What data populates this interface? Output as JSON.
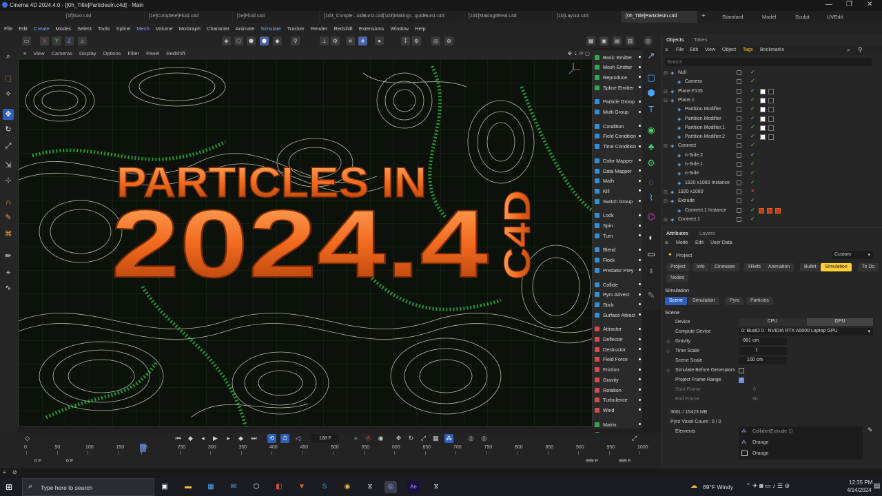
{
  "window": {
    "title": "Cinema 4D 2024.4.0 - [[0h_Title]ParticlesIn.c4d] - Main",
    "min": "—",
    "max": "❐",
    "close": "✕"
  },
  "file_tabs": [
    "[1f]Goo.c4d",
    "[1e]Complete]Fluid.c4d",
    "[1e]Fluid.c4d",
    "[1d3_Comple...uidBurst.c4d",
    "[1d3]MakingI...quidBurst.c4d",
    "[1d1]MakingItReal.c4d",
    "[1b]Layout.c4d",
    "[0h_Title]ParticlesIn.c4d"
  ],
  "tab_add": "+",
  "layout_tabs": [
    "Standard",
    "Model",
    "Sculpt",
    "UVEdit"
  ],
  "menu": [
    "File",
    "Edit",
    "Create",
    "Modes",
    "Select",
    "Tools",
    "Spline",
    "Mesh",
    "Volume",
    "MoGraph",
    "Character",
    "Animate",
    "Simulate",
    "Tracker",
    "Render",
    "Redshift",
    "Extensions",
    "Window",
    "Help"
  ],
  "toolbar": {
    "x": "X",
    "y": "Y",
    "z": "Z"
  },
  "viewport_menu": [
    "View",
    "Cameras",
    "Display",
    "Options",
    "Filter",
    "Panel",
    "Redshift"
  ],
  "scene": {
    "line1": "PARTICLES IN",
    "line2": "2024.4",
    "tag": "C4D"
  },
  "sim_groups": [
    {
      "color": "#2fa84a",
      "items": [
        "Basic Emitter",
        "Mesh Emitter",
        "Reproduce",
        "Spline Emitter"
      ]
    },
    {
      "color": "#2f8fd8",
      "items": [
        "Particle Group",
        "Multi Group"
      ]
    },
    {
      "color": "#2f8fd8",
      "items": [
        "Condition",
        "Field Condition",
        "Time Condition"
      ]
    },
    {
      "color": "#2f8fd8",
      "items": [
        "Color Mapper",
        "Data Mapper",
        "Math",
        "Kill",
        "Switch Group"
      ]
    },
    {
      "color": "#2f8fd8",
      "items": [
        "Look",
        "Spin",
        "Turn"
      ]
    },
    {
      "color": "#2f8fd8",
      "items": [
        "Blend",
        "Flock",
        "Predator Prey"
      ]
    },
    {
      "color": "#2f8fd8",
      "items": [
        "Collide",
        "Pyro Advect",
        "Stick",
        "Surface Attract"
      ]
    },
    {
      "color": "#d84a4a",
      "items": [
        "Attractor",
        "Deflector",
        "Destructor",
        "Field Force",
        "Friction",
        "Gravity",
        "Rotation",
        "Turbulence",
        "Wind"
      ]
    },
    {
      "color": "#2fa84a",
      "items": [
        "Matrix",
        "Tracer"
      ]
    }
  ],
  "objects_panel": {
    "tabs": [
      "Objects",
      "Takes"
    ],
    "menu": [
      "File",
      "Edit",
      "View",
      "Object",
      "Tags",
      "Bookmarks"
    ],
    "search_placeholder": "Search",
    "rows": [
      {
        "name": "Null",
        "indent": 0,
        "status": "check"
      },
      {
        "name": "Camera",
        "indent": 1,
        "status": "check"
      },
      {
        "name": "Plane.F135",
        "indent": 0,
        "status": "check"
      },
      {
        "name": "Plane.1",
        "indent": 0,
        "status": "check"
      },
      {
        "name": "Partition Modifier",
        "indent": 1,
        "status": "check"
      },
      {
        "name": "Partition Modifier",
        "indent": 1,
        "status": "check"
      },
      {
        "name": "Partition Modifier.1",
        "indent": 1,
        "status": "check"
      },
      {
        "name": "Partition Modifier.2",
        "indent": 1,
        "status": "check"
      },
      {
        "name": "Connect",
        "indent": 0,
        "status": "check"
      },
      {
        "name": "n-Side.2",
        "indent": 1,
        "status": "check"
      },
      {
        "name": "n-Side.1",
        "indent": 1,
        "status": "check"
      },
      {
        "name": "n-Side",
        "indent": 1,
        "status": "check"
      },
      {
        "name": "1920 x1080 Instance",
        "indent": 1,
        "status": "check"
      },
      {
        "name": "1920 x1080",
        "indent": 0,
        "status": "cross"
      },
      {
        "name": "Extrude",
        "indent": 0,
        "status": "check"
      },
      {
        "name": "Connect.1 Instance",
        "indent": 1,
        "status": "check"
      },
      {
        "name": "Connect.1",
        "indent": 0,
        "status": "check"
      }
    ]
  },
  "attributes": {
    "tabs": [
      "Attributes",
      "Layers"
    ],
    "menu": [
      "Mode",
      "Edit",
      "User Data"
    ],
    "object": "Project",
    "preset": "Custom",
    "tabs2": [
      "Project",
      "Info",
      "Cineware",
      "XRefs",
      "Animation",
      "Bullet",
      "Simulation",
      "To Do"
    ],
    "nodes": "Nodes",
    "section": "Simulation",
    "subtabs": [
      "Scene",
      "Simulation",
      "Pyro",
      "Particles"
    ],
    "scene_heading": "Scene",
    "device_label": "Device",
    "cpu": "CPU",
    "gpu": "GPU",
    "compute_label": "Compute Device",
    "compute_value": "0: BusID 0 : NVIDIA RTX A5000 Laptop GPU",
    "gravity_label": "Gravity",
    "gravity": "-981 cm",
    "timescale_label": "Time Scale",
    "timescale": "1",
    "scenescale_label": "Scene Scale",
    "scenescale": "100 cm",
    "simbefore_label": "Simulate Before Generators",
    "framerange_label": "Project Frame Range",
    "start_label": "Start Frame",
    "start": "0",
    "end_label": "End Frame",
    "end": "90",
    "mem": "3061 / 15423 MB",
    "voxel": "Pyro Voxel Count : 0 / 0",
    "elements_label": "Elements",
    "elements": [
      "Collider(Extrude 1)",
      "Orange",
      "Orange"
    ]
  },
  "timeline": {
    "frame": "188 F",
    "ticks": [
      "0",
      "50",
      "100",
      "150",
      "188",
      "250",
      "300",
      "350",
      "400",
      "450",
      "500",
      "550",
      "600",
      "650",
      "700",
      "750",
      "800",
      "850",
      "900",
      "950",
      "1000"
    ],
    "start1": "0 F",
    "start2": "0 F",
    "end1": "999 F",
    "end2": "999 F"
  },
  "taskbar": {
    "search": "Type here to search",
    "weather": "69°F Windy",
    "time": "12:35 PM",
    "date": "4/14/2024"
  }
}
